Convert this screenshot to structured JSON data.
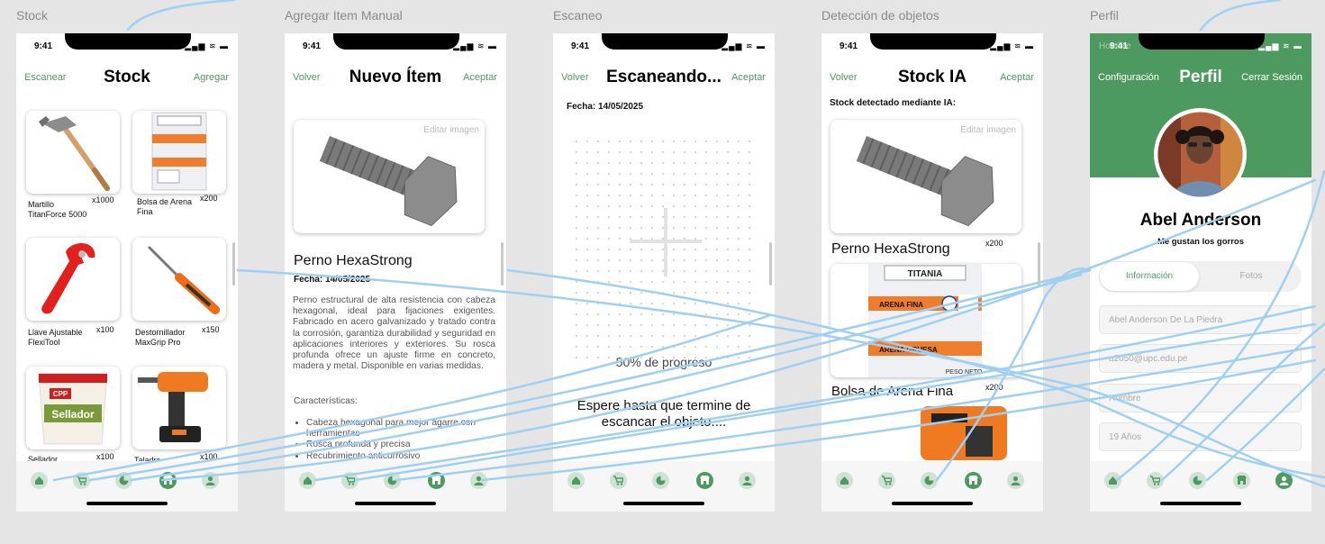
{
  "frames": {
    "stock": "Stock",
    "manual": "Agregar Item Manual",
    "scan": "Escaneo",
    "detect": "Detección de objetos",
    "profile": "Perfil"
  },
  "status_time": "9:41",
  "status_icons": "▂▄▆ ≋ ▬",
  "colors": {
    "accent": "#4c9a60",
    "accent_light": "#cfe2d4",
    "link": "#9fd0f2"
  },
  "stock": {
    "title": "Stock",
    "left": "Escanear",
    "right": "Agregar",
    "items": [
      {
        "name": "Martillo TitanForce 5000",
        "qty": "x1000",
        "icon": "hammer-icon"
      },
      {
        "name": "Bolsa de Arena Fina",
        "qty": "x200",
        "icon": "sand-bag-icon"
      },
      {
        "name": "Llave Ajustable FlexiTool",
        "qty": "x100",
        "icon": "wrench-icon"
      },
      {
        "name": "Destornillador MaxGrip Pro",
        "qty": "x150",
        "icon": "screwdriver-icon"
      },
      {
        "name": "Sellador",
        "qty": "x100",
        "icon": "sealant-bucket-icon"
      },
      {
        "name": "Taladro",
        "qty": "x100",
        "icon": "drill-icon"
      }
    ],
    "bag_brand": "TITANIA",
    "bag_label1": "ARENA FINA",
    "bag_label2": "ARENA GRUESA",
    "bucket_brand": "CPP",
    "bucket_label": "Sellador"
  },
  "manual": {
    "title": "Nuevo Ítem",
    "left": "Volver",
    "right": "Aceptar",
    "edit_image": "Editar imagen",
    "item_name": "Perno HexaStrong",
    "date": "Fecha: 14/05/2025",
    "description": "Perno estructural de alta resistencia con cabeza hexagonal, ideal para fijaciones exigentes. Fabricado en acero galvanizado y tratado contra la corrosión, garantiza durabilidad y seguridad en aplicaciones interiores y exteriores. Su rosca profunda ofrece un ajuste firme en concreto, madera y metal. Disponible en varias medidas.",
    "features_title": "Características:",
    "features": [
      "Cabeza hexagonal para mejor agarre con herramientas",
      "Rosca profunda y precisa",
      "Recubrimiento anticorrosivo"
    ]
  },
  "scan": {
    "title": "Escaneando...",
    "left": "Volver",
    "right": "Aceptar",
    "date": "Fecha: 14/05/2025",
    "progress": "50% de progreso",
    "progress_value": 0.5,
    "wait_text": "Espere hasta que termine de escancar el objeto...."
  },
  "detect": {
    "title": "Stock IA",
    "left": "Volver",
    "right": "Aceptar",
    "subtitle": "Stock detectado mediante IA:",
    "edit_image": "Editar imagen",
    "items": [
      {
        "name": "Perno HexaStrong",
        "qty": "x200"
      },
      {
        "name": "Bolsa de Arena Fina",
        "qty": "x200"
      }
    ],
    "bag_brand": "TITANIA",
    "bag_label1": "ARENA FINA",
    "bag_label2": "ARENA GRUESA",
    "bag_weight": "PESO NETO"
  },
  "profile": {
    "title": "Perfil",
    "left": "Configuración",
    "right": "Cerrar Sesión",
    "overlay": "Hombre",
    "name": "Abel Anderson",
    "bio": "Me gustan los gorros",
    "tabs": [
      "Información",
      "Fotos"
    ],
    "fields": [
      "Abel Anderson De La Piedra",
      "u2050@upc.edu.pe",
      "Hombre",
      "19 Años"
    ]
  },
  "tabbar": {
    "icons": [
      "home-icon",
      "cart-icon",
      "pie-chart-icon",
      "store-icon",
      "user-icon"
    ]
  }
}
